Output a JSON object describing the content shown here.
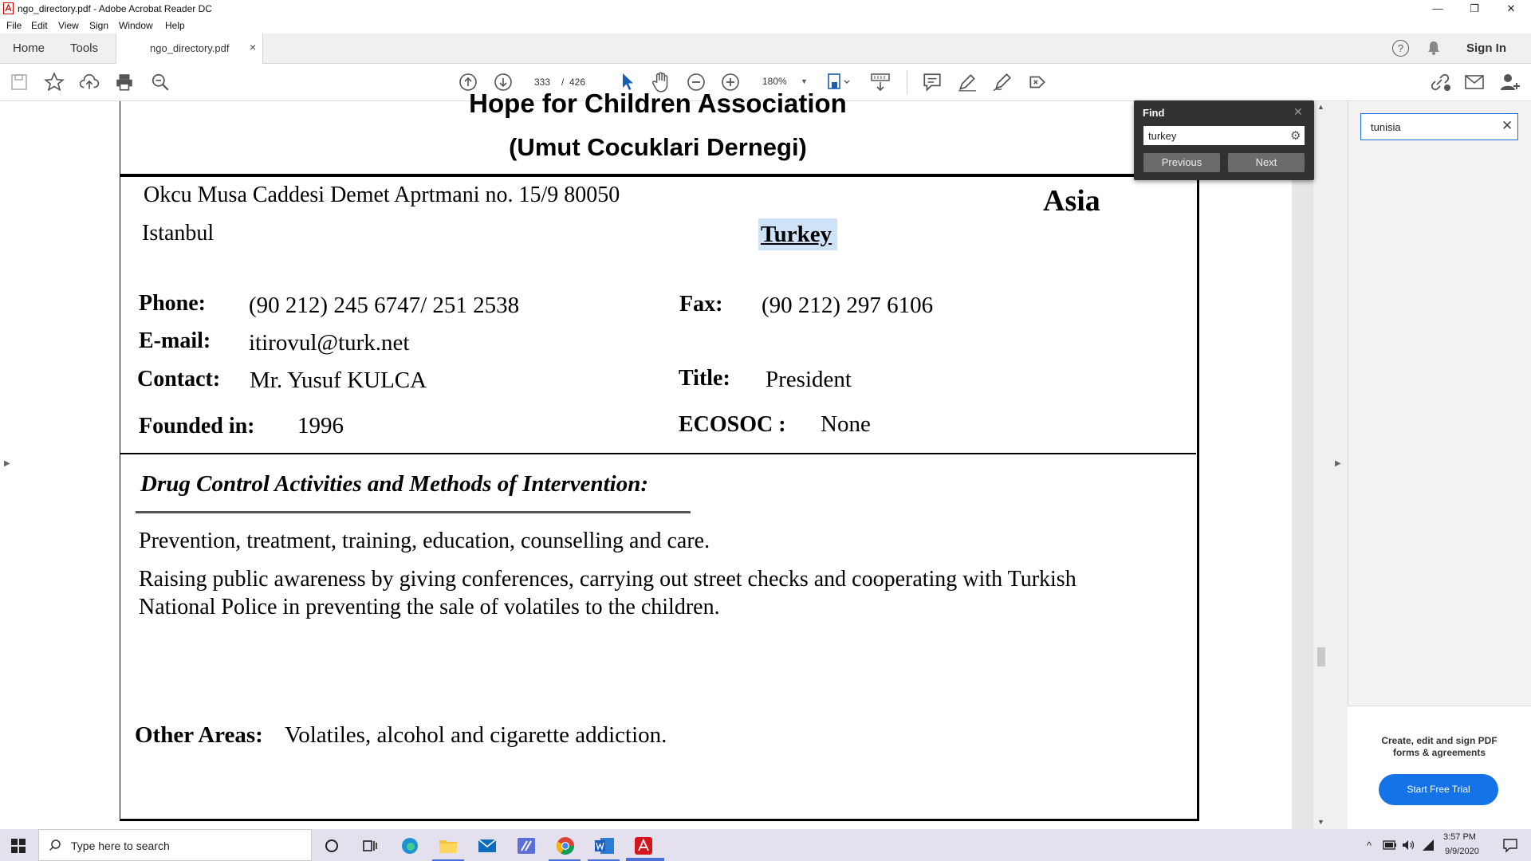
{
  "window": {
    "title": "ngo_directory.pdf - Adobe Acrobat Reader DC",
    "minimize": "—",
    "restore": "❐",
    "close": "✕"
  },
  "menu": [
    "File",
    "Edit",
    "View",
    "Sign",
    "Window",
    "Help"
  ],
  "tabs": {
    "home": "Home",
    "tools": "Tools",
    "document": "ngo_directory.pdf",
    "close": "×"
  },
  "header_right": {
    "help": "?",
    "sign_in": "Sign In"
  },
  "toolbar": {
    "page_current": "333",
    "page_sep": "/",
    "page_total": "426",
    "zoom": "180%"
  },
  "find": {
    "title": "Find",
    "query": "turkey",
    "previous": "Previous",
    "next": "Next"
  },
  "side_search": {
    "value": "tunisia"
  },
  "promo": {
    "text": "Create, edit and sign PDF forms & agreements",
    "button": "Start Free Trial"
  },
  "document": {
    "org_name": "Hope for Children Association",
    "org_name_local": "(Umut Cocuklari Dernegi)",
    "address1": "Okcu Musa Caddesi Demet Aprtmani no. 15/9 80050",
    "city": "Istanbul",
    "region": "Asia",
    "country": "Turkey",
    "phone_label": "Phone:",
    "phone": "(90 212) 245 6747/ 251 2538",
    "fax_label": "Fax:",
    "fax": "(90 212) 297 6106",
    "email_label": "E-mail:",
    "email": "itirovul@turk.net",
    "contact_label": "Contact:",
    "contact": "Mr. Yusuf KULCA",
    "title_label": "Title:",
    "title": "President",
    "founded_label": "Founded in:",
    "founded": "1996",
    "ecosoc_label": "ECOSOC :",
    "ecosoc": "None",
    "section_heading": "Drug Control Activities and Methods of Intervention:",
    "para1": "Prevention, treatment, training, education, counselling and care.",
    "para2_line1": "Raising public awareness by giving conferences, carrying out street checks and cooperating with Turkish",
    "para2_line2": "National Police in preventing the sale of volatiles to the children.",
    "other_label": "Other Areas:",
    "other": "Volatiles, alcohol and cigarette addiction."
  },
  "taskbar": {
    "search_placeholder": "Type here to search",
    "time": "3:57 PM",
    "date": "9/9/2020"
  },
  "colors": {
    "accent": "#1473e6",
    "find_bg": "#323232",
    "highlight": "#cfe3f8"
  }
}
